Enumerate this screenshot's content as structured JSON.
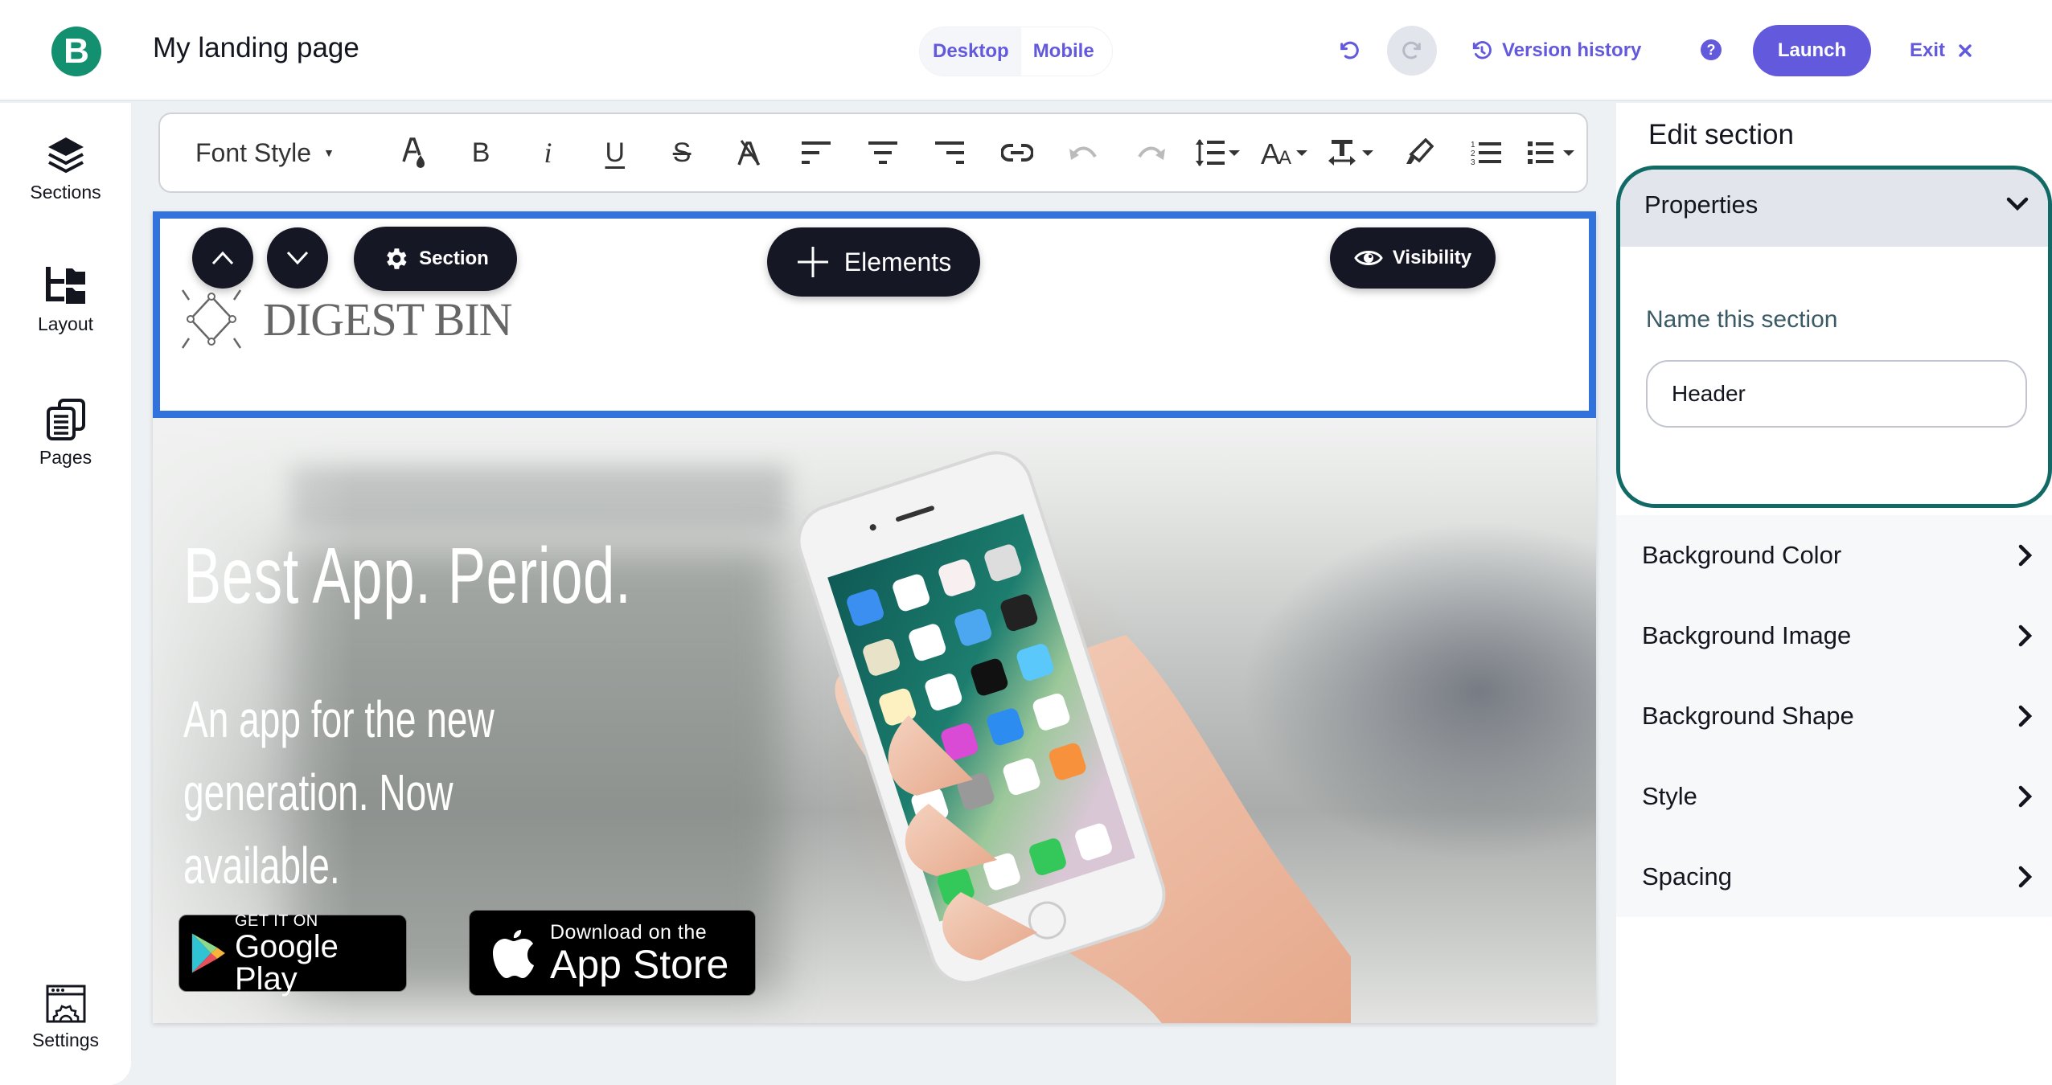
{
  "app": {
    "logo_letter": "B",
    "title": "My landing page",
    "brand_color": "#13906f",
    "accent_color": "#6359dd"
  },
  "topbar": {
    "view_modes": [
      "Desktop",
      "Mobile"
    ],
    "selected_view": "Desktop",
    "undo_icon": "undo-icon",
    "redo_icon": "redo-icon",
    "version_history_label": "Version history",
    "help_icon": "help-icon",
    "launch_label": "Launch",
    "exit_label": "Exit"
  },
  "sidebar": {
    "items": [
      {
        "label": "Sections",
        "icon": "layers-icon"
      },
      {
        "label": "Layout",
        "icon": "layout-tree-icon"
      },
      {
        "label": "Pages",
        "icon": "pages-icon"
      }
    ],
    "settings": {
      "label": "Settings",
      "icon": "settings-window-icon"
    }
  },
  "toolbar": {
    "font_style_label": "Font Style",
    "tools": [
      "text-color",
      "bold",
      "italic",
      "underline",
      "strikethrough",
      "clear-format",
      "align-left",
      "align-center",
      "align-right",
      "link",
      "undo",
      "redo",
      "line-height",
      "font-size",
      "letter-spacing",
      "highlight",
      "ordered-list",
      "unordered-list"
    ],
    "glyphs": {
      "bold": "B",
      "italic": "i",
      "underline": "U",
      "strike": "S"
    }
  },
  "canvas": {
    "section_controls": {
      "move_up_icon": "chevron-up-icon",
      "move_down_icon": "chevron-down-icon",
      "section_label": "Section",
      "elements_label": "Elements",
      "visibility_label": "Visibility"
    },
    "header": {
      "brand_name": "DIGEST BIN"
    },
    "hero": {
      "title": "Best App. Period.",
      "subtitle": "An app for the new generation. Now available.",
      "google_play": {
        "small": "GET IT ON",
        "big": "Google Play"
      },
      "app_store": {
        "small": "Download on the",
        "big": "App Store"
      }
    }
  },
  "right_panel": {
    "title": "Edit section",
    "properties": {
      "label": "Properties",
      "expanded": true,
      "field_label": "Name this section",
      "field_value": "Header"
    },
    "sections": [
      "Background Color",
      "Background Image",
      "Background Shape",
      "Style",
      "Spacing"
    ]
  }
}
